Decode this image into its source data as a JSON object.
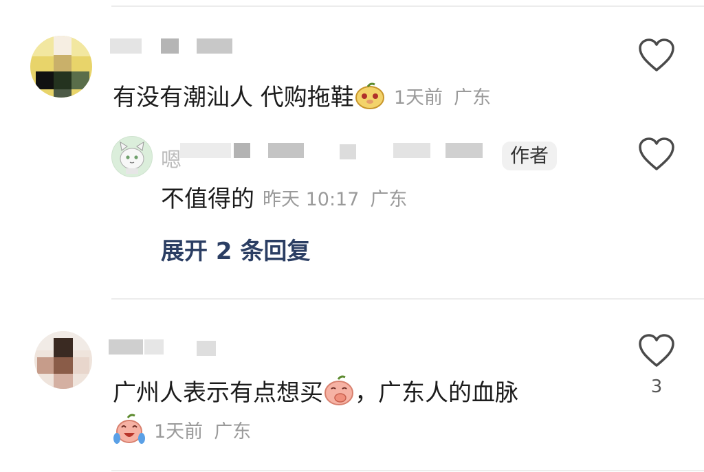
{
  "comments": [
    {
      "text": "有没有潮汕人 代购拖鞋",
      "time": "1天前",
      "location": "广东",
      "emoji": "mango-face-emoji",
      "reply": {
        "text": "不值得的",
        "time": "昨天 10:17",
        "location": "广东",
        "author_tag": "作者",
        "name_visible_char": "嗯"
      },
      "expand_label": "展开 2 条回复"
    },
    {
      "text_part1": "广州人表示有点想买",
      "text_part2": "，广东人的血脉",
      "time": "1天前",
      "location": "广东",
      "emoji1": "peach-covering-mouth-emoji",
      "emoji2": "peach-crying-laughing-emoji",
      "like_count": "3"
    }
  ],
  "icons": {
    "like": "heart-outline-icon"
  }
}
